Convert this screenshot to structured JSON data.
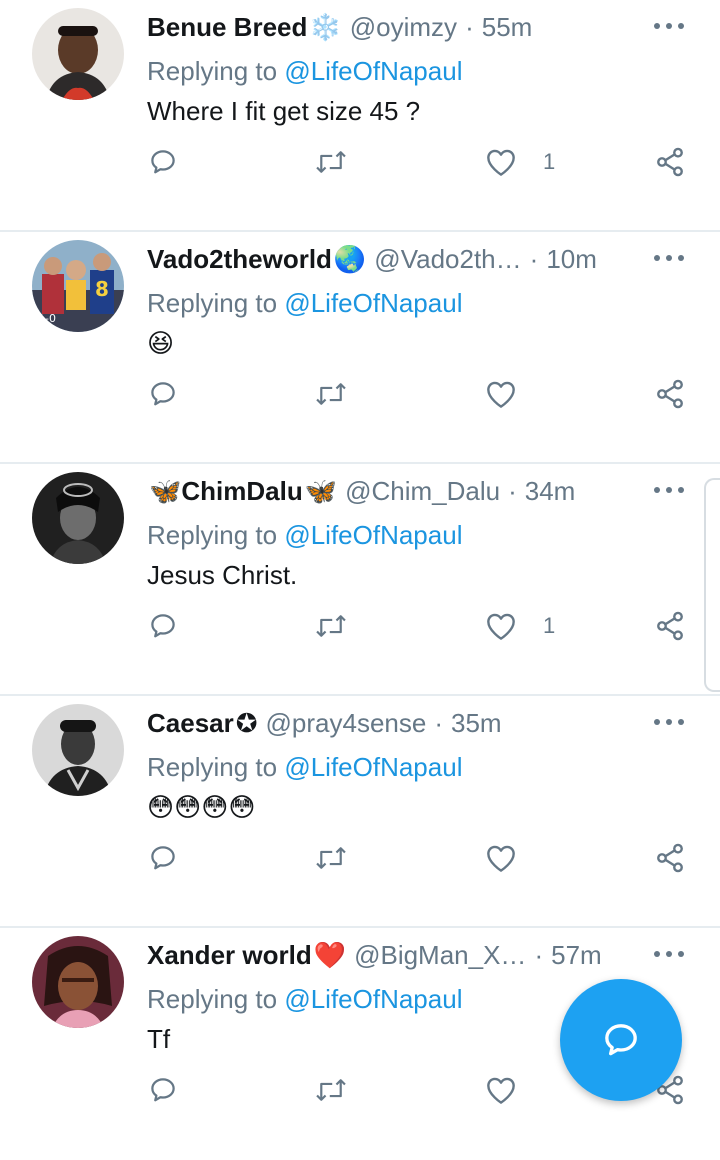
{
  "replying_label": "Replying to",
  "tweets": [
    {
      "name": "Benue Breed",
      "name_emoji": "❄️",
      "handle": "@oyimzy",
      "time": "55m",
      "replying_to": "@LifeOfNapaul",
      "text": "Where I fit get size 45 ?",
      "likes": "1"
    },
    {
      "name": "Vado2theworld",
      "name_emoji": "🌏",
      "handle": "@Vado2th…",
      "time": "10m",
      "replying_to": "@LifeOfNapaul",
      "text": "😆",
      "likes": ""
    },
    {
      "name": "ChimDalu",
      "name_prefix_emoji": "🦋",
      "name_emoji": "🦋",
      "handle": "@Chim_Dalu",
      "time": "34m",
      "replying_to": "@LifeOfNapaul",
      "text": "Jesus Christ.",
      "likes": "1"
    },
    {
      "name": "Caesar",
      "name_emoji": "✪",
      "handle": "@pray4sense",
      "time": "35m",
      "replying_to": "@LifeOfNapaul",
      "text": "😳😳😳😳",
      "likes": ""
    },
    {
      "name": "Xander world",
      "name_emoji": "❤️",
      "handle": "@BigMan_X…",
      "time": "57m",
      "replying_to": "@LifeOfNapaul",
      "text": "Tf",
      "likes": ""
    }
  ],
  "colors": {
    "accent": "#1da1f2",
    "mention": "#1b95e0",
    "secondary_text": "#657786",
    "divider": "#e6ecf0"
  },
  "icons": {
    "reply": "reply-icon",
    "retweet": "retweet-icon",
    "like": "heart-icon",
    "share": "share-icon",
    "more": "more-icon",
    "compose": "compose-reply-icon"
  }
}
